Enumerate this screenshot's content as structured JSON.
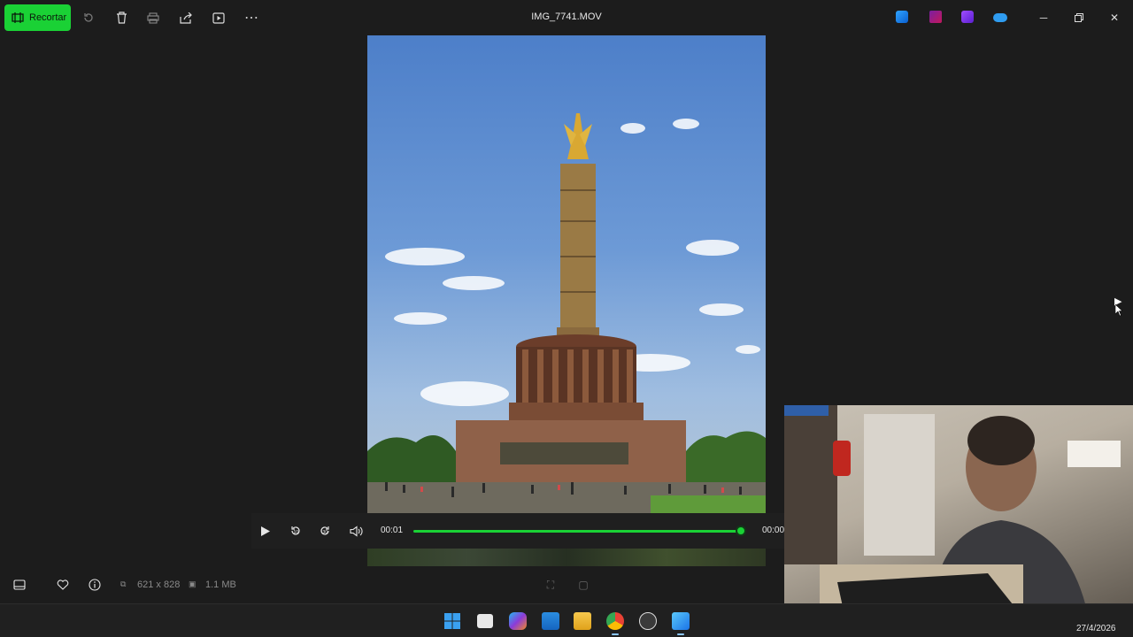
{
  "toolbar": {
    "edit_label": "Recortar",
    "edit_icon": "crop-icon",
    "rotate_icon": "rotate-icon",
    "delete_icon": "trash-icon",
    "print_icon": "print-icon",
    "share_icon": "share-icon",
    "slideshow_icon": "slideshow-icon",
    "more_icon": "more-icon"
  },
  "window": {
    "title": "IMG_7741.MOV",
    "minimize_icon": "minimize-icon",
    "restore_icon": "restore-icon",
    "close_icon": "close-icon"
  },
  "player": {
    "current_time": "00:01",
    "total_time": "00:00",
    "progress": 0.99
  },
  "statusbar": {
    "dimensions": "621 x 828",
    "file_size": "1.1 MB"
  },
  "taskbar": {
    "date": "27/4/2026"
  },
  "colors": {
    "accent": "#1ad135",
    "background": "#1c1c1c",
    "taskbar": "#202020"
  }
}
